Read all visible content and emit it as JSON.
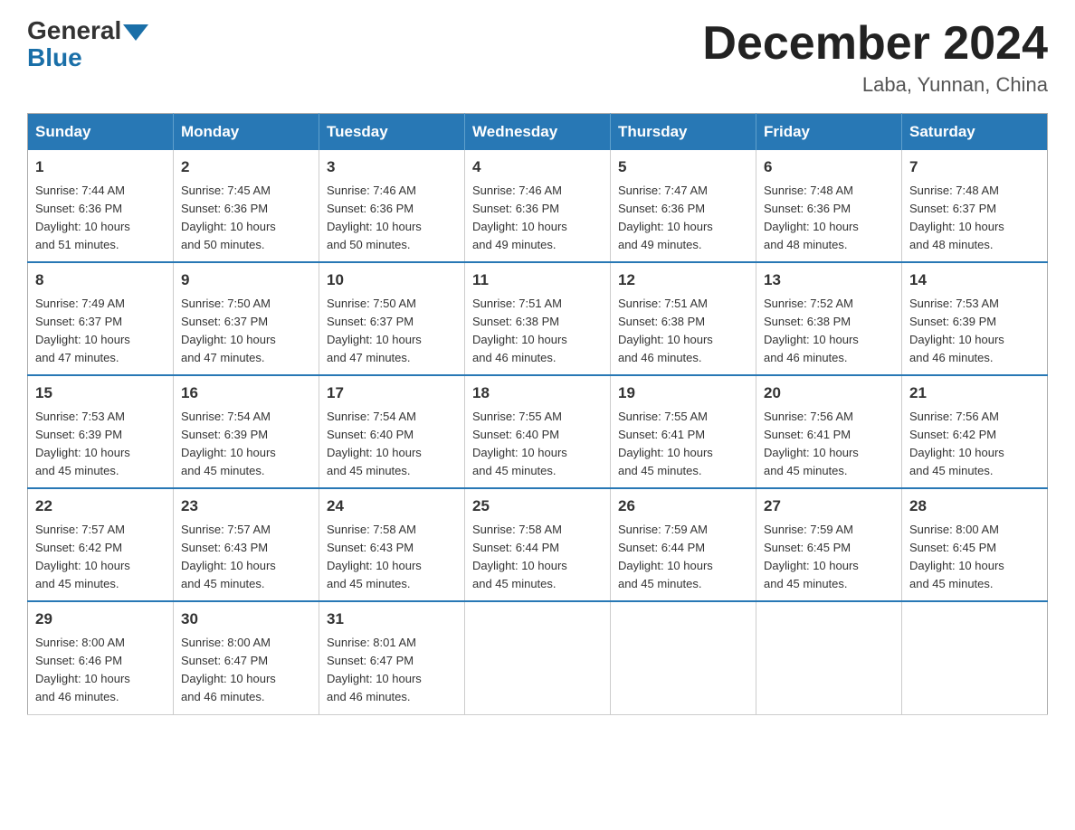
{
  "header": {
    "logo_general": "General",
    "logo_blue": "Blue",
    "month_title": "December 2024",
    "location": "Laba, Yunnan, China"
  },
  "weekdays": [
    "Sunday",
    "Monday",
    "Tuesday",
    "Wednesday",
    "Thursday",
    "Friday",
    "Saturday"
  ],
  "weeks": [
    [
      {
        "day": "1",
        "info": "Sunrise: 7:44 AM\nSunset: 6:36 PM\nDaylight: 10 hours\nand 51 minutes."
      },
      {
        "day": "2",
        "info": "Sunrise: 7:45 AM\nSunset: 6:36 PM\nDaylight: 10 hours\nand 50 minutes."
      },
      {
        "day": "3",
        "info": "Sunrise: 7:46 AM\nSunset: 6:36 PM\nDaylight: 10 hours\nand 50 minutes."
      },
      {
        "day": "4",
        "info": "Sunrise: 7:46 AM\nSunset: 6:36 PM\nDaylight: 10 hours\nand 49 minutes."
      },
      {
        "day": "5",
        "info": "Sunrise: 7:47 AM\nSunset: 6:36 PM\nDaylight: 10 hours\nand 49 minutes."
      },
      {
        "day": "6",
        "info": "Sunrise: 7:48 AM\nSunset: 6:36 PM\nDaylight: 10 hours\nand 48 minutes."
      },
      {
        "day": "7",
        "info": "Sunrise: 7:48 AM\nSunset: 6:37 PM\nDaylight: 10 hours\nand 48 minutes."
      }
    ],
    [
      {
        "day": "8",
        "info": "Sunrise: 7:49 AM\nSunset: 6:37 PM\nDaylight: 10 hours\nand 47 minutes."
      },
      {
        "day": "9",
        "info": "Sunrise: 7:50 AM\nSunset: 6:37 PM\nDaylight: 10 hours\nand 47 minutes."
      },
      {
        "day": "10",
        "info": "Sunrise: 7:50 AM\nSunset: 6:37 PM\nDaylight: 10 hours\nand 47 minutes."
      },
      {
        "day": "11",
        "info": "Sunrise: 7:51 AM\nSunset: 6:38 PM\nDaylight: 10 hours\nand 46 minutes."
      },
      {
        "day": "12",
        "info": "Sunrise: 7:51 AM\nSunset: 6:38 PM\nDaylight: 10 hours\nand 46 minutes."
      },
      {
        "day": "13",
        "info": "Sunrise: 7:52 AM\nSunset: 6:38 PM\nDaylight: 10 hours\nand 46 minutes."
      },
      {
        "day": "14",
        "info": "Sunrise: 7:53 AM\nSunset: 6:39 PM\nDaylight: 10 hours\nand 46 minutes."
      }
    ],
    [
      {
        "day": "15",
        "info": "Sunrise: 7:53 AM\nSunset: 6:39 PM\nDaylight: 10 hours\nand 45 minutes."
      },
      {
        "day": "16",
        "info": "Sunrise: 7:54 AM\nSunset: 6:39 PM\nDaylight: 10 hours\nand 45 minutes."
      },
      {
        "day": "17",
        "info": "Sunrise: 7:54 AM\nSunset: 6:40 PM\nDaylight: 10 hours\nand 45 minutes."
      },
      {
        "day": "18",
        "info": "Sunrise: 7:55 AM\nSunset: 6:40 PM\nDaylight: 10 hours\nand 45 minutes."
      },
      {
        "day": "19",
        "info": "Sunrise: 7:55 AM\nSunset: 6:41 PM\nDaylight: 10 hours\nand 45 minutes."
      },
      {
        "day": "20",
        "info": "Sunrise: 7:56 AM\nSunset: 6:41 PM\nDaylight: 10 hours\nand 45 minutes."
      },
      {
        "day": "21",
        "info": "Sunrise: 7:56 AM\nSunset: 6:42 PM\nDaylight: 10 hours\nand 45 minutes."
      }
    ],
    [
      {
        "day": "22",
        "info": "Sunrise: 7:57 AM\nSunset: 6:42 PM\nDaylight: 10 hours\nand 45 minutes."
      },
      {
        "day": "23",
        "info": "Sunrise: 7:57 AM\nSunset: 6:43 PM\nDaylight: 10 hours\nand 45 minutes."
      },
      {
        "day": "24",
        "info": "Sunrise: 7:58 AM\nSunset: 6:43 PM\nDaylight: 10 hours\nand 45 minutes."
      },
      {
        "day": "25",
        "info": "Sunrise: 7:58 AM\nSunset: 6:44 PM\nDaylight: 10 hours\nand 45 minutes."
      },
      {
        "day": "26",
        "info": "Sunrise: 7:59 AM\nSunset: 6:44 PM\nDaylight: 10 hours\nand 45 minutes."
      },
      {
        "day": "27",
        "info": "Sunrise: 7:59 AM\nSunset: 6:45 PM\nDaylight: 10 hours\nand 45 minutes."
      },
      {
        "day": "28",
        "info": "Sunrise: 8:00 AM\nSunset: 6:45 PM\nDaylight: 10 hours\nand 45 minutes."
      }
    ],
    [
      {
        "day": "29",
        "info": "Sunrise: 8:00 AM\nSunset: 6:46 PM\nDaylight: 10 hours\nand 46 minutes."
      },
      {
        "day": "30",
        "info": "Sunrise: 8:00 AM\nSunset: 6:47 PM\nDaylight: 10 hours\nand 46 minutes."
      },
      {
        "day": "31",
        "info": "Sunrise: 8:01 AM\nSunset: 6:47 PM\nDaylight: 10 hours\nand 46 minutes."
      },
      null,
      null,
      null,
      null
    ]
  ]
}
